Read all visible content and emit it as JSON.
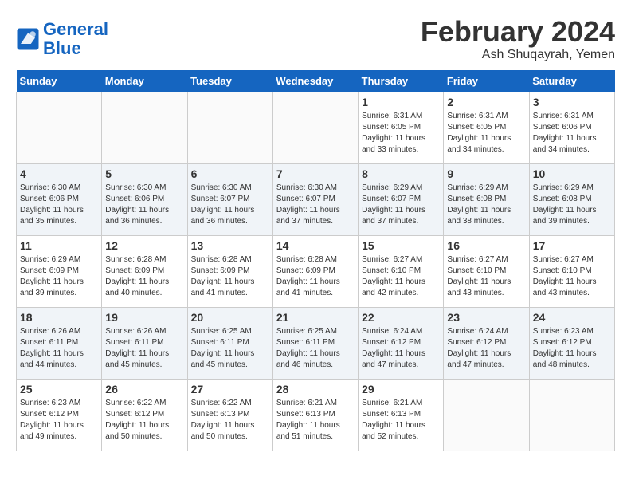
{
  "header": {
    "logo_line1": "General",
    "logo_line2": "Blue",
    "title": "February 2024",
    "subtitle": "Ash Shuqayrah, Yemen"
  },
  "days_of_week": [
    "Sunday",
    "Monday",
    "Tuesday",
    "Wednesday",
    "Thursday",
    "Friday",
    "Saturday"
  ],
  "weeks": [
    [
      {
        "day": "",
        "empty": true
      },
      {
        "day": "",
        "empty": true
      },
      {
        "day": "",
        "empty": true
      },
      {
        "day": "",
        "empty": true
      },
      {
        "day": "1",
        "sunrise": "6:31 AM",
        "sunset": "6:05 PM",
        "daylight": "11 hours and 33 minutes."
      },
      {
        "day": "2",
        "sunrise": "6:31 AM",
        "sunset": "6:05 PM",
        "daylight": "11 hours and 34 minutes."
      },
      {
        "day": "3",
        "sunrise": "6:31 AM",
        "sunset": "6:06 PM",
        "daylight": "11 hours and 34 minutes."
      }
    ],
    [
      {
        "day": "4",
        "sunrise": "6:30 AM",
        "sunset": "6:06 PM",
        "daylight": "11 hours and 35 minutes."
      },
      {
        "day": "5",
        "sunrise": "6:30 AM",
        "sunset": "6:06 PM",
        "daylight": "11 hours and 36 minutes."
      },
      {
        "day": "6",
        "sunrise": "6:30 AM",
        "sunset": "6:07 PM",
        "daylight": "11 hours and 36 minutes."
      },
      {
        "day": "7",
        "sunrise": "6:30 AM",
        "sunset": "6:07 PM",
        "daylight": "11 hours and 37 minutes."
      },
      {
        "day": "8",
        "sunrise": "6:29 AM",
        "sunset": "6:07 PM",
        "daylight": "11 hours and 37 minutes."
      },
      {
        "day": "9",
        "sunrise": "6:29 AM",
        "sunset": "6:08 PM",
        "daylight": "11 hours and 38 minutes."
      },
      {
        "day": "10",
        "sunrise": "6:29 AM",
        "sunset": "6:08 PM",
        "daylight": "11 hours and 39 minutes."
      }
    ],
    [
      {
        "day": "11",
        "sunrise": "6:29 AM",
        "sunset": "6:09 PM",
        "daylight": "11 hours and 39 minutes."
      },
      {
        "day": "12",
        "sunrise": "6:28 AM",
        "sunset": "6:09 PM",
        "daylight": "11 hours and 40 minutes."
      },
      {
        "day": "13",
        "sunrise": "6:28 AM",
        "sunset": "6:09 PM",
        "daylight": "11 hours and 41 minutes."
      },
      {
        "day": "14",
        "sunrise": "6:28 AM",
        "sunset": "6:09 PM",
        "daylight": "11 hours and 41 minutes."
      },
      {
        "day": "15",
        "sunrise": "6:27 AM",
        "sunset": "6:10 PM",
        "daylight": "11 hours and 42 minutes."
      },
      {
        "day": "16",
        "sunrise": "6:27 AM",
        "sunset": "6:10 PM",
        "daylight": "11 hours and 43 minutes."
      },
      {
        "day": "17",
        "sunrise": "6:27 AM",
        "sunset": "6:10 PM",
        "daylight": "11 hours and 43 minutes."
      }
    ],
    [
      {
        "day": "18",
        "sunrise": "6:26 AM",
        "sunset": "6:11 PM",
        "daylight": "11 hours and 44 minutes."
      },
      {
        "day": "19",
        "sunrise": "6:26 AM",
        "sunset": "6:11 PM",
        "daylight": "11 hours and 45 minutes."
      },
      {
        "day": "20",
        "sunrise": "6:25 AM",
        "sunset": "6:11 PM",
        "daylight": "11 hours and 45 minutes."
      },
      {
        "day": "21",
        "sunrise": "6:25 AM",
        "sunset": "6:11 PM",
        "daylight": "11 hours and 46 minutes."
      },
      {
        "day": "22",
        "sunrise": "6:24 AM",
        "sunset": "6:12 PM",
        "daylight": "11 hours and 47 minutes."
      },
      {
        "day": "23",
        "sunrise": "6:24 AM",
        "sunset": "6:12 PM",
        "daylight": "11 hours and 47 minutes."
      },
      {
        "day": "24",
        "sunrise": "6:23 AM",
        "sunset": "6:12 PM",
        "daylight": "11 hours and 48 minutes."
      }
    ],
    [
      {
        "day": "25",
        "sunrise": "6:23 AM",
        "sunset": "6:12 PM",
        "daylight": "11 hours and 49 minutes."
      },
      {
        "day": "26",
        "sunrise": "6:22 AM",
        "sunset": "6:12 PM",
        "daylight": "11 hours and 50 minutes."
      },
      {
        "day": "27",
        "sunrise": "6:22 AM",
        "sunset": "6:13 PM",
        "daylight": "11 hours and 50 minutes."
      },
      {
        "day": "28",
        "sunrise": "6:21 AM",
        "sunset": "6:13 PM",
        "daylight": "11 hours and 51 minutes."
      },
      {
        "day": "29",
        "sunrise": "6:21 AM",
        "sunset": "6:13 PM",
        "daylight": "11 hours and 52 minutes."
      },
      {
        "day": "",
        "empty": true
      },
      {
        "day": "",
        "empty": true
      }
    ]
  ],
  "labels": {
    "sunrise_prefix": "Sunrise: ",
    "sunset_prefix": "Sunset: ",
    "daylight_label": "Daylight: "
  }
}
